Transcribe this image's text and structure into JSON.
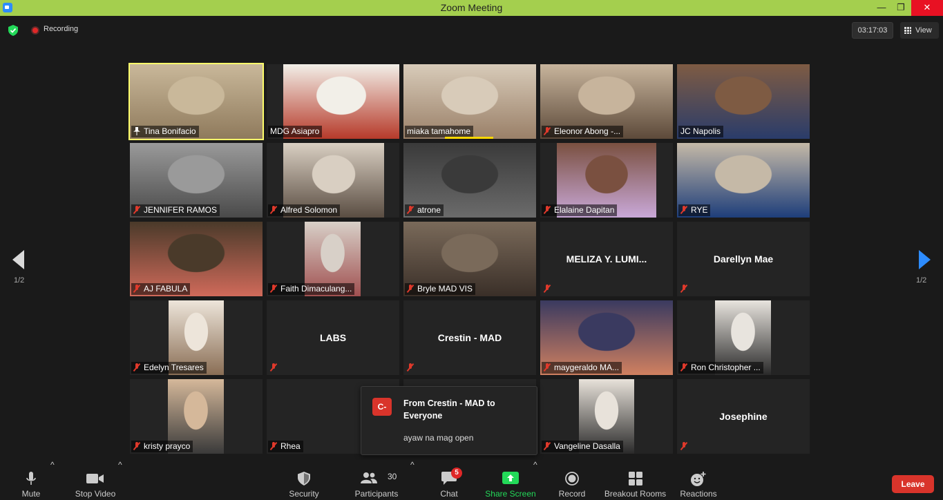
{
  "window": {
    "title": "Zoom Meeting"
  },
  "topbar": {
    "recording_label": "Recording",
    "timer": "03:17:03",
    "view_label": "View"
  },
  "pager": {
    "left": "1/2",
    "right": "1/2"
  },
  "participants": [
    {
      "name": "Tina Bonifacio",
      "muted": false,
      "video": true,
      "active": true
    },
    {
      "name": "MDG Asiapro",
      "muted": false,
      "video": true
    },
    {
      "name": "miaka tamahome",
      "muted": false,
      "video": true,
      "speaking": true
    },
    {
      "name": "Eleonor Abong -...",
      "muted": true,
      "video": true
    },
    {
      "name": "JC Napolis",
      "muted": false,
      "video": true
    },
    {
      "name": "JENNIFER RAMOS",
      "muted": true,
      "video": true
    },
    {
      "name": "Alfred Solomon",
      "muted": true,
      "video": true
    },
    {
      "name": "atrone",
      "muted": true,
      "video": true
    },
    {
      "name": "Elalaine Dapitan",
      "muted": true,
      "video": true
    },
    {
      "name": "RYE",
      "muted": true,
      "video": true
    },
    {
      "name": "AJ FABULA",
      "muted": true,
      "video": true
    },
    {
      "name": "Faith Dimaculang...",
      "muted": true,
      "video": true
    },
    {
      "name": "Bryle MAD VIS",
      "muted": true,
      "video": true
    },
    {
      "name": "",
      "big_name": "MELIZA Y. LUMI...",
      "muted": true,
      "video": false
    },
    {
      "name": "",
      "big_name": "Darellyn Mae",
      "muted": true,
      "video": false
    },
    {
      "name": "Edelyn Tresares",
      "muted": true,
      "video": true
    },
    {
      "name": "",
      "big_name": "LABS",
      "muted": true,
      "video": false
    },
    {
      "name": "",
      "big_name": "Crestin - MAD",
      "muted": true,
      "video": false
    },
    {
      "name": "maygeraldo MA...",
      "muted": true,
      "video": true
    },
    {
      "name": "Ron Christopher ...",
      "muted": true,
      "video": true
    },
    {
      "name": "kristy prayco",
      "muted": true,
      "video": true
    },
    {
      "name": "Rhea",
      "muted": true,
      "video": false
    },
    {
      "name": "",
      "muted": true,
      "video": false,
      "hidden": true
    },
    {
      "name": "Vangeline Dasalla",
      "muted": true,
      "video": true
    },
    {
      "name": "",
      "big_name": "Josephine",
      "muted": true,
      "video": false
    }
  ],
  "chat_popup": {
    "avatar": "C-",
    "from": "From Crestin - MAD to Everyone",
    "message": "ayaw na mag open"
  },
  "toolbar": {
    "mute": "Mute",
    "stop_video": "Stop Video",
    "security": "Security",
    "participants": "Participants",
    "participants_count": "30",
    "chat": "Chat",
    "chat_badge": "5",
    "share_screen": "Share Screen",
    "record": "Record",
    "breakout_rooms": "Breakout Rooms",
    "reactions": "Reactions",
    "leave": "Leave"
  },
  "colors": {
    "titlebar": "#a4cf4e",
    "active_speaker": "#ffff6b",
    "share_green": "#23d959",
    "leave_red": "#d9342b",
    "accent_blue": "#2d8cff"
  }
}
